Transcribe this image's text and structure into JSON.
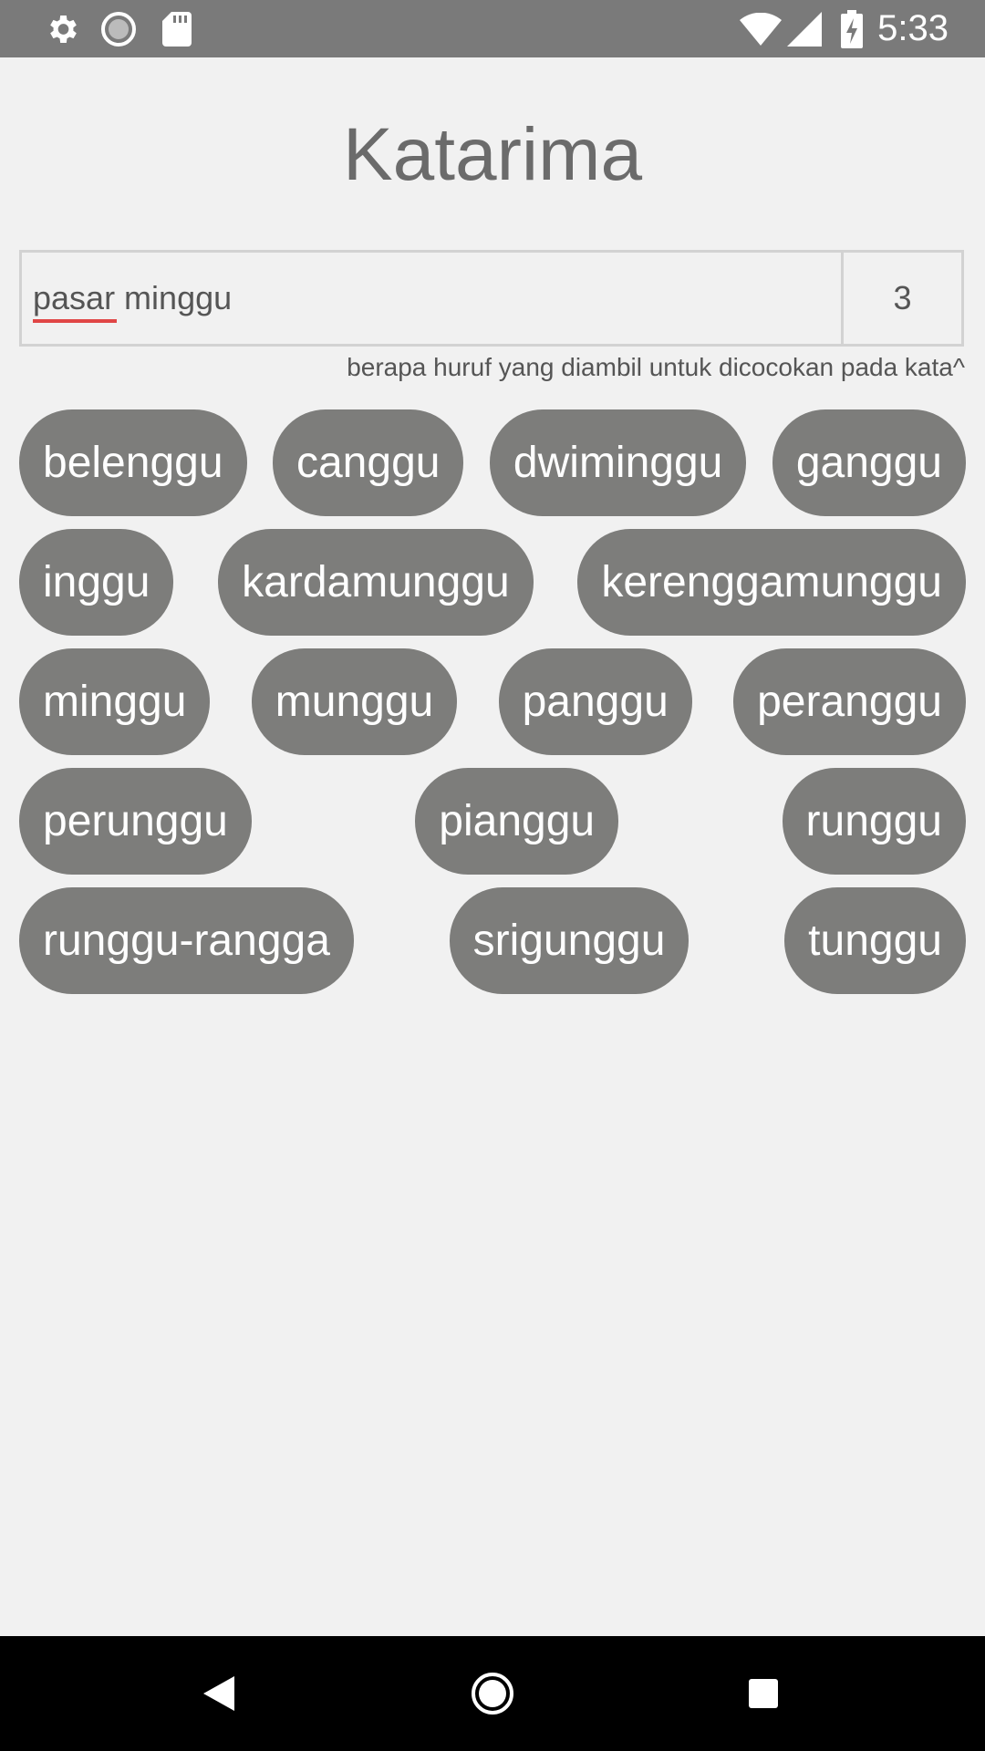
{
  "status_bar": {
    "time": "5:33",
    "icons": [
      "gear-icon",
      "loading-icon",
      "sd-card-icon",
      "wifi-icon",
      "signal-icon",
      "battery-charging-icon"
    ]
  },
  "app": {
    "title": "Katarima"
  },
  "search": {
    "word_value": "pasar minggu",
    "misspelled_word": "pasar",
    "count_value": "3",
    "hint": "berapa huruf yang diambil untuk dicocokan pada kata^"
  },
  "results": {
    "rows": [
      [
        "belenggu",
        "canggu",
        "dwiminggu",
        "ganggu"
      ],
      [
        "inggu",
        "kardamunggu",
        "kerenggamunggu"
      ],
      [
        "minggu",
        "munggu",
        "panggu",
        "peranggu"
      ],
      [
        "perunggu",
        "pianggu",
        "runggu"
      ],
      [
        "runggu-rangga",
        "srigunggu",
        "tunggu"
      ]
    ]
  },
  "colors": {
    "status_bar": "#7a7a7a",
    "background": "#f1f1f1",
    "chip": "#7d7d7b",
    "title": "#6b6b6b",
    "spell_underline": "#e04646",
    "nav_bar": "#000000"
  },
  "nav_bar": {
    "icons": [
      "back-icon",
      "home-icon",
      "recents-icon"
    ]
  }
}
